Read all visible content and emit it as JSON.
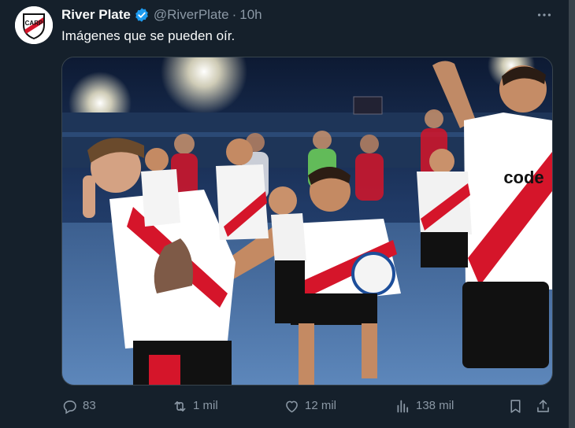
{
  "tweet": {
    "author_name": "River Plate",
    "handle": "@RiverPlate",
    "separator": "·",
    "time": "10h",
    "text": "Imágenes que se pueden oír.",
    "avatar_initials": "CARP",
    "media_alt_icon": "photo-celebration",
    "jersey_sponsor": "code"
  },
  "actions": {
    "replies": "83",
    "retweets": "1 mil",
    "likes": "12 mil",
    "views": "138 mil"
  },
  "colors": {
    "background": "#15202b",
    "text": "#f7f9f9",
    "secondary": "#8b98a5",
    "verified": "#1d9bf0",
    "river_red": "#d5152a"
  }
}
